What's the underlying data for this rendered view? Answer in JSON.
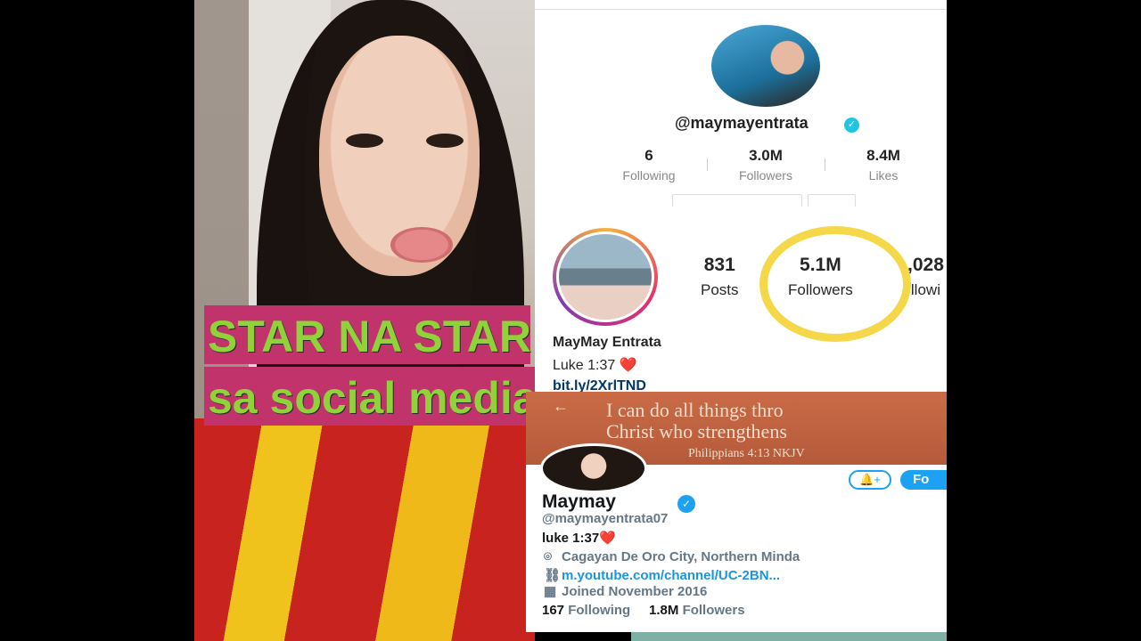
{
  "overlay": {
    "line1": "STAR NA STAR",
    "line2": "sa social media"
  },
  "tiktok": {
    "handle": "@maymayentrata",
    "stats": [
      {
        "value": "6",
        "label": "Following"
      },
      {
        "value": "3.0M",
        "label": "Followers"
      },
      {
        "value": "8.4M",
        "label": "Likes"
      }
    ]
  },
  "instagram": {
    "stats": [
      {
        "value": "831",
        "label": "Posts"
      },
      {
        "value": "5.1M",
        "label": "Followers"
      },
      {
        "value": ",028",
        "label": "llowi"
      }
    ],
    "name": "MayMay Entrata",
    "bio": "Luke 1:37 ❤️",
    "link": "bit.ly/2XrlTND",
    "highlight_color": "#f3d53a"
  },
  "twitter": {
    "banner_lines": [
      "I can do all things thro",
      "Christ who strengthens",
      "Philippians 4:13 NKJV"
    ],
    "follow_label": "Fo",
    "name": "Maymay",
    "handle": "@maymayentrata07",
    "bio": "luke 1:37❤️",
    "location": "Cagayan De Oro City, Northern Minda",
    "website": "m.youtube.com/channel/UC-2BN...",
    "joined": "Joined November 2016",
    "following_count": "167",
    "following_label": "Following",
    "followers_count": "1.8M",
    "followers_label": "Followers",
    "accent": "#1da1f2"
  }
}
